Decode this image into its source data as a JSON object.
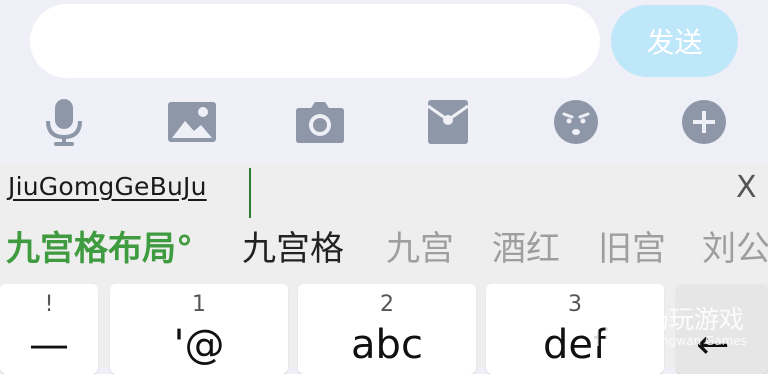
{
  "chat": {
    "input_value": "",
    "send_label": "发送",
    "toolbar_icons": [
      "microphone-icon",
      "image-icon",
      "camera-icon",
      "red-packet-icon",
      "emoji-icon",
      "plus-icon"
    ]
  },
  "ime": {
    "composing_text": "JiuGomgGeBuJu",
    "close_label": "X",
    "candidates": [
      "九宫格布局°",
      "九宫格",
      "九宫",
      "酒红",
      "旧宫",
      "刘公"
    ],
    "keys": [
      {
        "num": "!",
        "label": "—"
      },
      {
        "num": "1",
        "label": "'@"
      },
      {
        "num": "2",
        "label": "abc"
      },
      {
        "num": "3",
        "label": "def"
      },
      {
        "num": "",
        "label": "←"
      }
    ]
  },
  "watermark": {
    "title": "仍玩游戏",
    "subtitle": "Rengwan Games"
  },
  "colors": {
    "send_button": "#bfe7fa",
    "icon_gray": "#8e97a8",
    "candidate_highlight": "#3f9b3f",
    "background": "#eff0f7"
  }
}
